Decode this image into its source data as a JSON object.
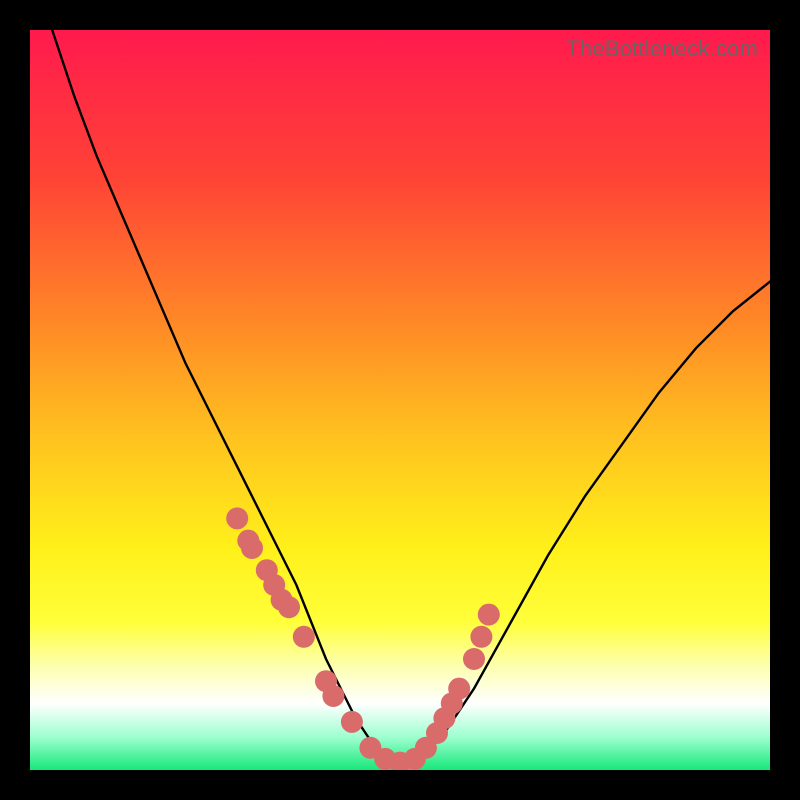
{
  "watermark": "TheBottleneck.com",
  "colors": {
    "background": "#000000",
    "gradient_stops": [
      {
        "offset": 0.0,
        "color": "#ff1a4d"
      },
      {
        "offset": 0.2,
        "color": "#ff4336"
      },
      {
        "offset": 0.4,
        "color": "#ff8a26"
      },
      {
        "offset": 0.55,
        "color": "#ffc21f"
      },
      {
        "offset": 0.7,
        "color": "#fff01a"
      },
      {
        "offset": 0.8,
        "color": "#ffff3a"
      },
      {
        "offset": 0.86,
        "color": "#fdffb0"
      },
      {
        "offset": 0.91,
        "color": "#ffffff"
      },
      {
        "offset": 0.955,
        "color": "#9fffd0"
      },
      {
        "offset": 1.0,
        "color": "#17e87a"
      }
    ],
    "curve": "#000000",
    "dot_fill": "#d96b6b",
    "dot_stroke": "#d96b6b"
  },
  "chart_data": {
    "type": "line",
    "title": "",
    "xlabel": "",
    "ylabel": "",
    "xlim": [
      0,
      100
    ],
    "ylim": [
      0,
      100
    ],
    "series": [
      {
        "name": "bottleneck-curve",
        "x": [
          3,
          6,
          9,
          12,
          15,
          18,
          21,
          24,
          27,
          30,
          33,
          36,
          38,
          40,
          42,
          44,
          46,
          48,
          50,
          53,
          56,
          60,
          65,
          70,
          75,
          80,
          85,
          90,
          95,
          100
        ],
        "y": [
          100,
          91,
          83,
          76,
          69,
          62,
          55,
          49,
          43,
          37,
          31,
          25,
          20,
          15,
          11,
          7,
          4,
          2,
          1,
          2,
          5,
          11,
          20,
          29,
          37,
          44,
          51,
          57,
          62,
          66
        ]
      }
    ],
    "points": {
      "name": "sample-dots",
      "x": [
        28,
        29.5,
        30,
        32,
        33,
        34,
        35,
        37,
        40,
        41,
        43.5,
        46,
        48,
        50,
        52,
        53.5,
        55,
        56,
        57,
        58,
        60,
        61,
        62
      ],
      "y": [
        34,
        31,
        30,
        27,
        25,
        23,
        22,
        18,
        12,
        10,
        6.5,
        3,
        1.5,
        1,
        1.5,
        3,
        5,
        7,
        9,
        11,
        15,
        18,
        21
      ]
    },
    "annotations": [
      {
        "text": "TheBottleneck.com",
        "position": "top-right"
      }
    ]
  }
}
